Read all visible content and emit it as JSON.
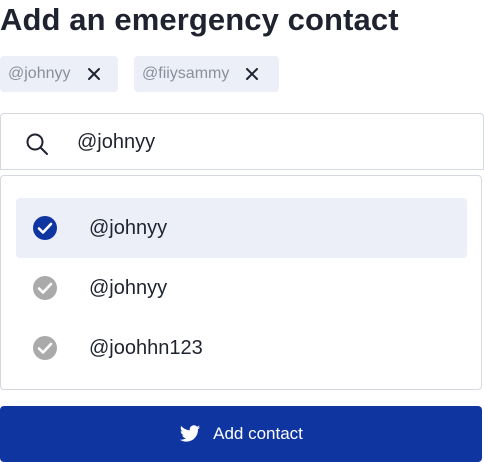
{
  "title": "Add an emergency contact",
  "chips": [
    {
      "label": "@johnyy"
    },
    {
      "label": "@fiiysammy"
    }
  ],
  "search": {
    "value": "@johnyy",
    "icon": "search-icon"
  },
  "options": [
    {
      "label": "@johnyy",
      "selected": true
    },
    {
      "label": "@johnyy",
      "selected": false
    },
    {
      "label": "@joohhn123",
      "selected": false
    }
  ],
  "button": {
    "label": "Add contact",
    "icon": "twitter-icon"
  },
  "colors": {
    "accent": "#0f35a0",
    "selected_bg": "#eceff8",
    "chip_bg": "#eceff7",
    "check_inactive": "#aaaaaa"
  }
}
